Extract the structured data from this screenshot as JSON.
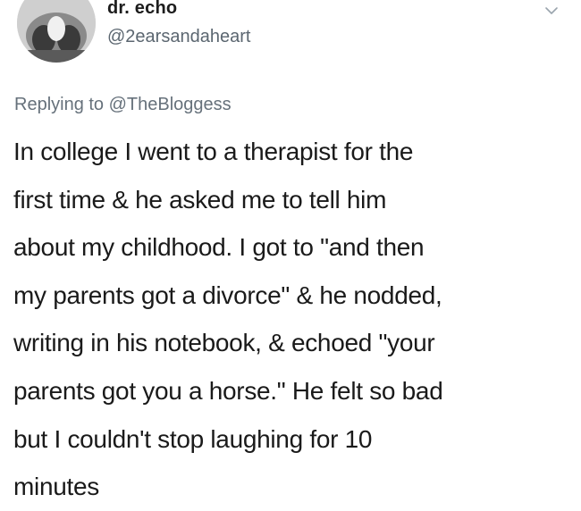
{
  "tweet": {
    "display_name": "dr. echo",
    "handle": "@2earsandaheart",
    "avatar_icon": "avatar-photo",
    "menu_icon": "chevron-down-icon",
    "reply_prefix": "Replying to ",
    "reply_to": "@TheBloggess",
    "text_lines": [
      "In college I went to a therapist for the",
      "first time & he asked me to tell him",
      "about my childhood. I got to \"and then",
      "my parents got a divorce\" & he nodded,",
      "writing in his notebook, & echoed \"your",
      "parents got you a horse.\" He felt so bad",
      "but I couldn't stop laughing for 10",
      "minutes"
    ]
  },
  "colors": {
    "text": "#1a1a1a",
    "secondary_text": "#5b6670",
    "background": "#ffffff"
  }
}
